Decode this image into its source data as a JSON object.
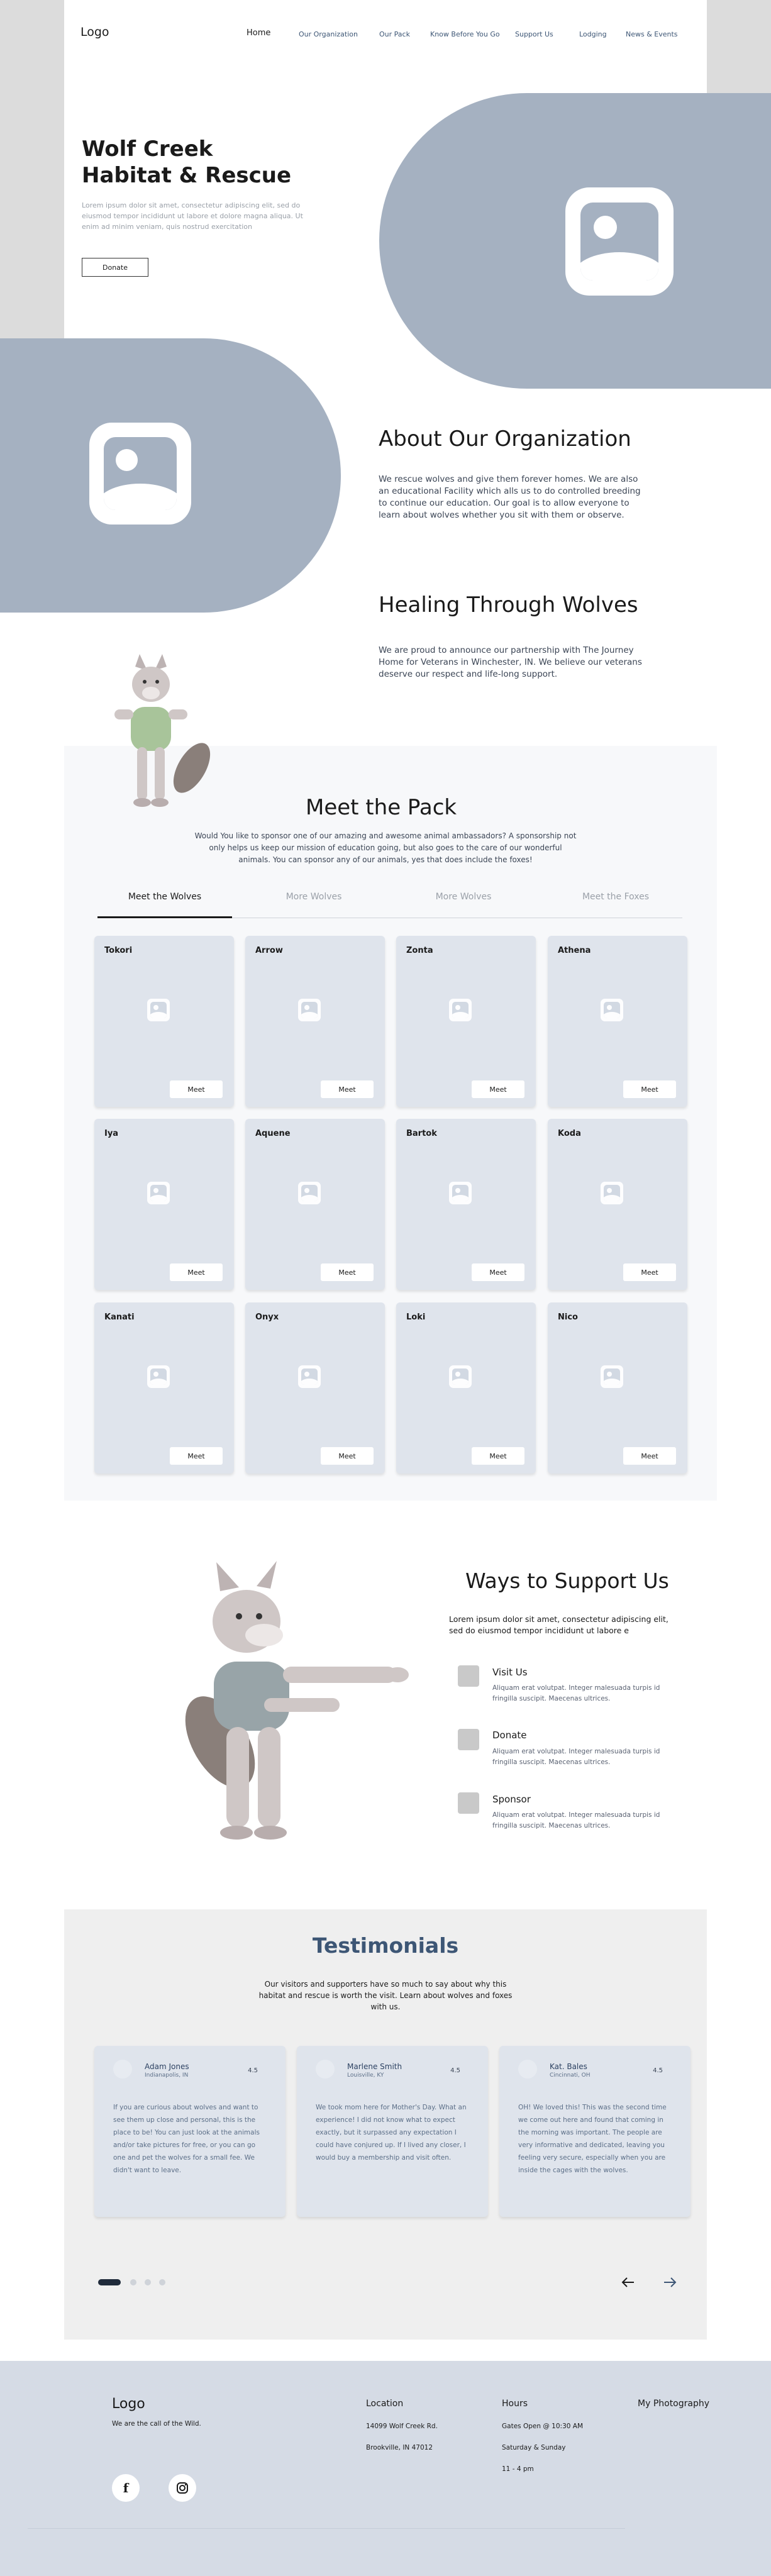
{
  "nav": {
    "logo": "Logo",
    "links": [
      "Home",
      "Our Organization",
      "Our Pack",
      "Know Before You Go",
      "Support Us",
      "Lodging",
      "News & Events"
    ]
  },
  "hero": {
    "title_line1": "Wolf Creek",
    "title_line2": "Habitat & Rescue",
    "text": "Lorem ipsum dolor sit amet, consectetur adipiscing elit, sed do eiusmod tempor incididunt ut labore et dolore magna aliqua. Ut enim ad minim veniam, quis nostrud exercitation",
    "button": "Donate",
    "image_icon": "image-placeholder-icon"
  },
  "about": {
    "heading": "About Our Organization",
    "text": "We rescue wolves and give them forever homes. We are also an educational Facility which alls us to do controlled breeding to continue our education. Our goal is to allow everyone to learn about wolves whether you sit with them or observe."
  },
  "healing": {
    "heading": "Healing Through Wolves",
    "text": "We are proud to announce our partnership with The Journey Home for Veterans in Winchester, IN. We believe our veterans deserve our respect and life-long support."
  },
  "pack": {
    "heading": "Meet the Pack",
    "text": "Would You like to sponsor one of our amazing and awesome animal ambassadors? A sponsorship not only helps us keep our mission of education going, but also goes to the care of our wonderful animals. You can sponsor any of our animals, yes that does include the foxes!",
    "tabs": [
      "Meet the Wolves",
      "More Wolves",
      "More Wolves",
      "Meet the Foxes"
    ],
    "meet_label": "Meet",
    "wolves": [
      "Tokori",
      "Arrow",
      "Zonta",
      "Athena",
      "Iya",
      "Aquene",
      "Bartok",
      "Koda",
      "Kanati",
      "Onyx",
      "Loki",
      "Nico"
    ]
  },
  "support": {
    "heading": "Ways to Support Us",
    "text": "Lorem ipsum dolor sit amet, consectetur adipiscing elit, sed do eiusmod tempor incididunt ut labore e",
    "ways": [
      {
        "title": "Visit Us",
        "text": "Aliquam erat volutpat. Integer malesuada turpis id fringilla suscipit. Maecenas ultrices."
      },
      {
        "title": "Donate",
        "text": "Aliquam erat volutpat. Integer malesuada turpis id fringilla suscipit. Maecenas ultrices."
      },
      {
        "title": "Sponsor",
        "text": "Aliquam erat volutpat. Integer malesuada turpis id fringilla suscipit. Maecenas ultrices."
      }
    ]
  },
  "testimonials": {
    "heading": "Testimonials",
    "text": "Our visitors and supporters have so much to say about why this habitat and rescue is worth the visit. Learn about wolves and foxes with us.",
    "items": [
      {
        "name": "Adam Jones",
        "location": "Indianapolis, IN",
        "rating": "4.5",
        "text": "If you are curious about wolves and want to see them up close and personal, this is the place to be! You can just look at the animals and/or take pictures for free, or you can go one and pet the wolves for a small fee. We didn't want to leave."
      },
      {
        "name": "Marlene Smith",
        "location": "Louisville, KY",
        "rating": "4.5",
        "text": "We took mom here for Mother's Day. What an experience! I did not know what to expect exactly, but it surpassed any expectation I could have conjured up. If I lived any closer, I would buy a membership and visit often."
      },
      {
        "name": "Kat. Bales",
        "location": "Cincinnati, OH",
        "rating": "4.5",
        "text": "OH! We loved this! This was the second time we come out here and found that coming in the morning was important. The people are very informative and dedicated, leaving you feeling very secure, especially when you are inside the cages with the wolves."
      }
    ],
    "prev_icon": "arrow-left-icon",
    "next_icon": "arrow-right-icon"
  },
  "footer": {
    "logo": "Logo",
    "tagline": "We are the call of the Wild.",
    "location_heading": "Location",
    "address1": "14099 Wolf Creek Rd.",
    "address2": "Brookville, IN 47012",
    "hours_heading": "Hours",
    "hours1": "Gates Open @ 10:30 AM",
    "hours2": "Saturday & Sunday",
    "hours3": "11 - 4 pm",
    "photography_heading": "My Photography",
    "social_icons": [
      "facebook-icon",
      "instagram-icon"
    ]
  },
  "colors": {
    "accent_grey_blue": "#a5b1c1",
    "card_bg": "#dfe4ec",
    "footer_bg": "#d5dbe5",
    "testimonial_heading": "#3d5675"
  }
}
